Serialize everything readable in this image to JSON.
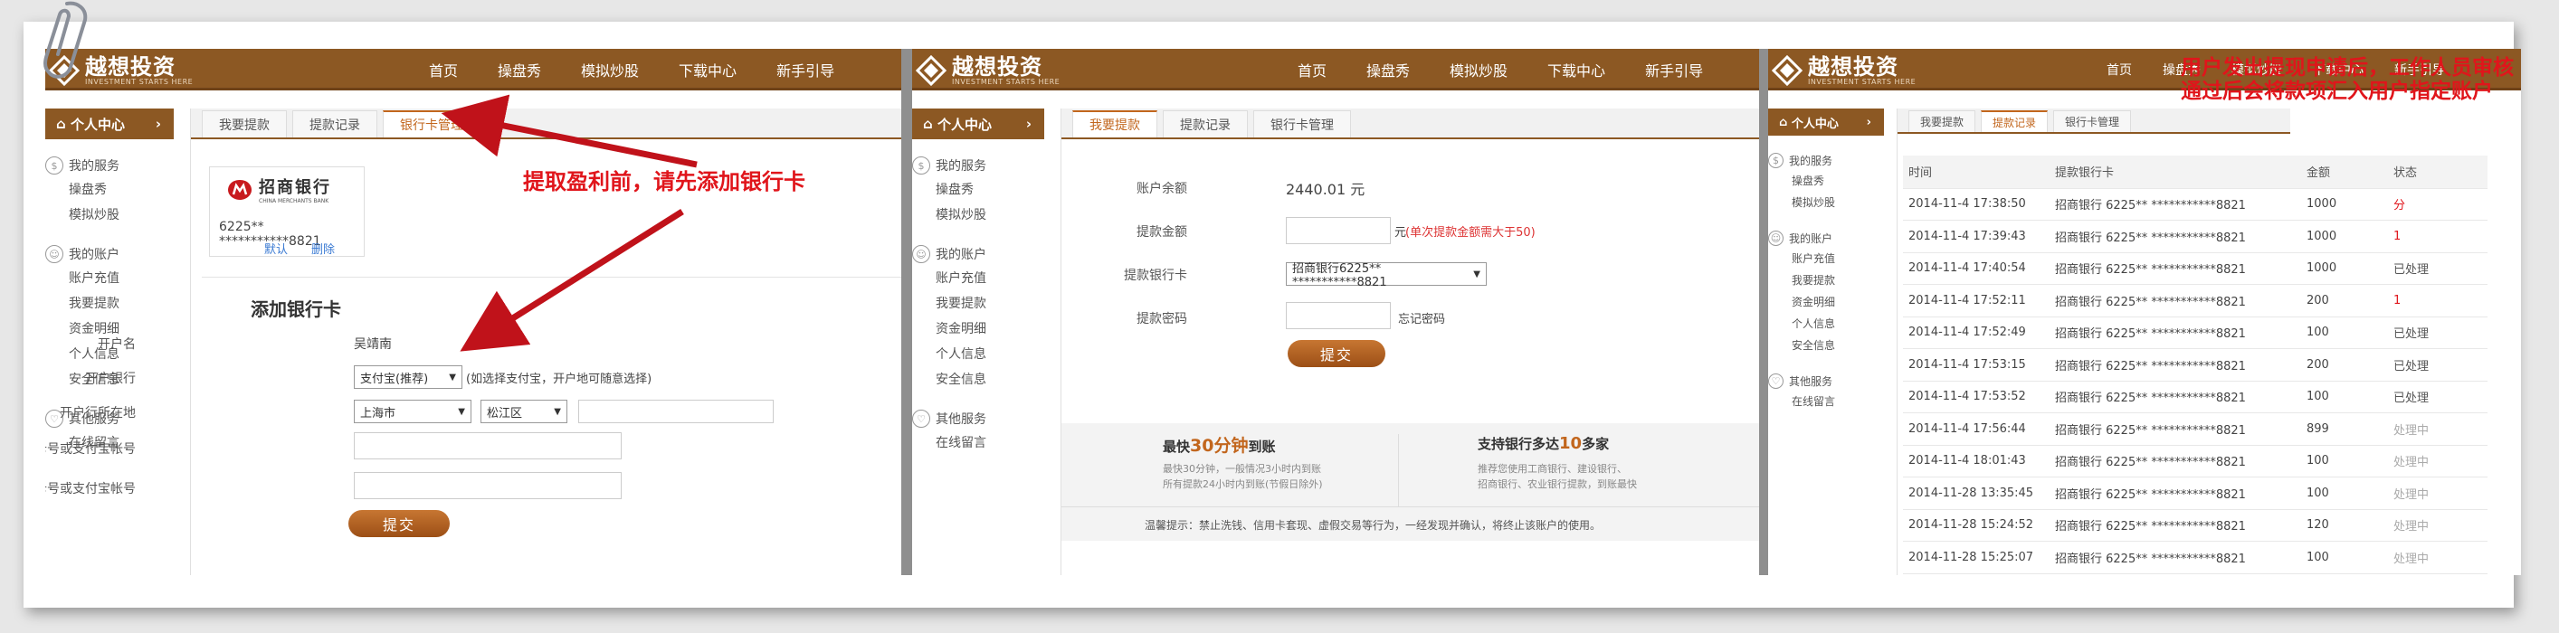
{
  "brand": {
    "name": "越想投资",
    "slogan": "INVESTMENT STARTS HERE"
  },
  "nav": [
    "首页",
    "操盘秀",
    "模拟炒股",
    "下载中心",
    "新手引导"
  ],
  "sidebar": {
    "title": "个人中心",
    "groups": [
      {
        "title": "我的服务",
        "items": [
          "操盘秀",
          "模拟炒股"
        ]
      },
      {
        "title": "我的账户",
        "items": [
          "账户充值",
          "我要提款",
          "资金明细",
          "个人信息",
          "安全信息"
        ]
      },
      {
        "title": "其他服务",
        "items": [
          "在线留言"
        ]
      }
    ]
  },
  "tabs": [
    "我要提款",
    "提款记录",
    "银行卡管理"
  ],
  "panel1": {
    "bank_name": "招商银行",
    "bank_name_en": "CHINA MERCHANTS BANK",
    "card_number": "6225** ***********8821",
    "default_link": "默认",
    "delete_link": "删除",
    "form_title": "添加银行卡",
    "account_name_label": "开户名",
    "account_name": "吴靖南",
    "bank_label": "开户银行",
    "bank_select": "支付宝(推荐)",
    "bank_hint": "(如选择支付宝，开户地可随意选择)",
    "location_label": "开户行所在地",
    "province": "上海市",
    "district": "松江区",
    "card_label": "银行卡号或支付宝帐号",
    "confirm_label": "确认卡号或支付宝帐号",
    "submit": "提交",
    "annotation": "提取盈利前，请先添加银行卡"
  },
  "panel2": {
    "balance_label": "账户余额",
    "balance": "2440.01 元",
    "amount_label": "提款金额",
    "amount_unit": "元",
    "amount_note": "(单次提款金额需大于50)",
    "card_label": "提款银行卡",
    "card_select": "招商银行6225** ***********8821",
    "pwd_label": "提款密码",
    "forgot": "忘记密码",
    "submit": "提交",
    "promo1_a": "最快",
    "promo1_b": "30分钟",
    "promo1_c": "到账",
    "promo1_d1": "最快30分钟，一般情况3小时内到账",
    "promo1_d2": "所有提款24小时内到账(节假日除外)",
    "promo2_a": "支持银行多达",
    "promo2_b": "10",
    "promo2_c": "多家",
    "promo2_d1": "推荐您使用工商银行、建设银行、",
    "promo2_d2": "招商银行、农业银行提款，到账最快",
    "warning": "温馨提示：禁止洗钱、信用卡套现、虚假交易等行为，一经发现并确认，将终止该账户的使用。"
  },
  "panel3": {
    "annotation": "用户发出提现申请后，工作人员审核通过后会将款项汇入用户指定账户",
    "headers": [
      "时间",
      "提款银行卡",
      "金额",
      "状态"
    ],
    "rows": [
      [
        "2014-11-4 17:38:50",
        "招商银行 6225** ***********8821",
        "1000",
        "分"
      ],
      [
        "2014-11-4 17:39:43",
        "招商银行 6225** ***********8821",
        "1000",
        "1"
      ],
      [
        "2014-11-4 17:40:54",
        "招商银行 6225** ***********8821",
        "1000",
        "已处理"
      ],
      [
        "2014-11-4 17:52:11",
        "招商银行 6225** ***********8821",
        "200",
        "1"
      ],
      [
        "2014-11-4 17:52:49",
        "招商银行 6225** ***********8821",
        "100",
        "已处理"
      ],
      [
        "2014-11-4 17:53:15",
        "招商银行 6225** ***********8821",
        "200",
        "已处理"
      ],
      [
        "2014-11-4 17:53:52",
        "招商银行 6225** ***********8821",
        "100",
        "已处理"
      ],
      [
        "2014-11-4 17:56:44",
        "招商银行 6225** ***********8821",
        "899",
        "处理中"
      ],
      [
        "2014-11-4 18:01:43",
        "招商银行 6225** ***********8821",
        "100",
        "处理中"
      ],
      [
        "2014-11-28 13:35:45",
        "招商银行 6225** ***********8821",
        "100",
        "处理中"
      ],
      [
        "2014-11-28 15:24:52",
        "招商银行 6225** ***********8821",
        "120",
        "处理中"
      ],
      [
        "2014-11-28 15:25:07",
        "招商银行 6225** ***********8821",
        "100",
        "处理中"
      ]
    ]
  },
  "colors": {
    "brand": "#8c5823",
    "accent": "#c2661d",
    "annotation": "#e0151b",
    "status_error": "#e0151b"
  }
}
